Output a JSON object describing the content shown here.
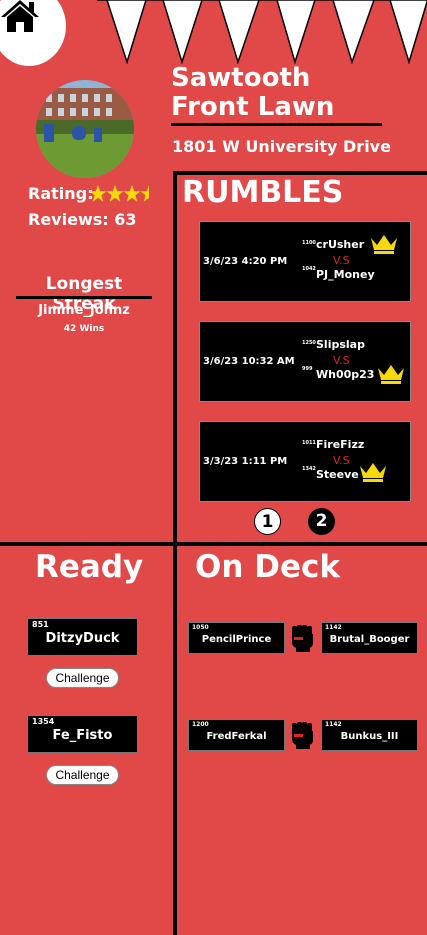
{
  "venue": {
    "name_line1": "Sawtooth",
    "name_line2": "Front Lawn",
    "address": "1801 W University Drive",
    "rating_label": "Rating:",
    "rating": 3.5,
    "rating_max": 5,
    "reviews_label": "Reviews: 63"
  },
  "streak": {
    "heading": "Longest Streak",
    "player": "Jimme_Johnz",
    "wins": "42 Wins"
  },
  "rumbles": {
    "heading": "RUMBLES",
    "matches": [
      {
        "date": "3/6/23 4:20 PM",
        "p1_rating": "1100",
        "p1": "crUsher",
        "vs": "V.S",
        "p2_rating": "1042",
        "p2": "PJ_Money",
        "winner": 1
      },
      {
        "date": "3/6/23 10:32 AM",
        "p1_rating": "1250",
        "p1": "Slipslap",
        "vs": "V.S",
        "p2_rating": "999",
        "p2": "Wh00p23",
        "winner": 2
      },
      {
        "date": "3/3/23 1:11 PM",
        "p1_rating": "1011",
        "p1": "FireFizz",
        "vs": "V.S",
        "p2_rating": "1342",
        "p2": "Steeve",
        "winner": 2
      }
    ],
    "pages": [
      "1",
      "2"
    ],
    "current_page": 1
  },
  "ready": {
    "heading": "Ready",
    "players": [
      {
        "rating": "851",
        "name": "DitzyDuck",
        "action": "Challenge"
      },
      {
        "rating": "1354",
        "name": "Fe_Fisto",
        "action": "Challenge"
      }
    ]
  },
  "ondeck": {
    "heading": "On Deck",
    "matchups": [
      {
        "p1_rating": "1050",
        "p1": "PencilPrince",
        "p2_rating": "1142",
        "p2": "Brutal_Booger"
      },
      {
        "p1_rating": "1200",
        "p1": "FredFerkal",
        "p2_rating": "1142",
        "p2": "Bunkus_III"
      }
    ]
  },
  "colors": {
    "background": "#e14848",
    "card": "#000000",
    "crown": "#f5d90a",
    "vs": "#e02020",
    "star": "#f5d90a"
  },
  "icons": {
    "home": "home-icon",
    "crown": "crown-icon",
    "fist": "fist-icon",
    "star": "star-icon"
  }
}
